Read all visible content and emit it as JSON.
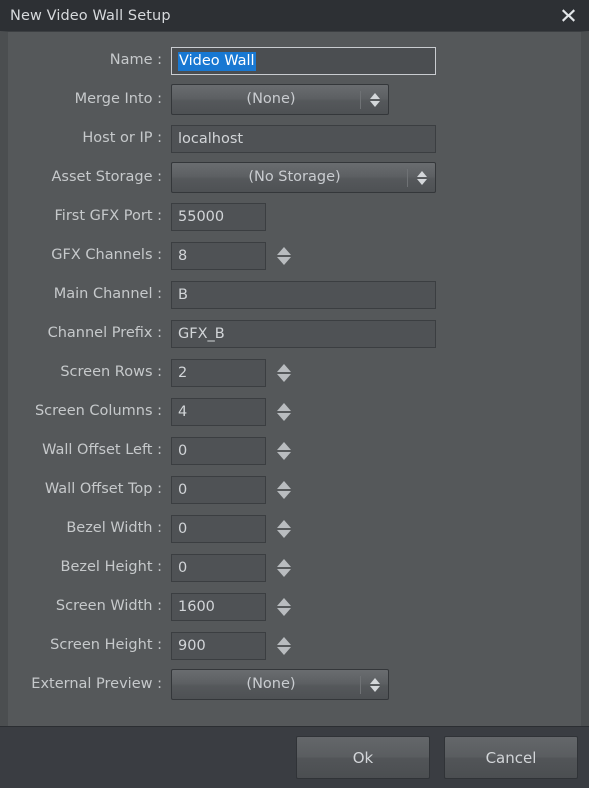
{
  "window": {
    "title": "New Video Wall Setup",
    "close_icon": "close-icon"
  },
  "colors": {
    "titlebar_bg": "#2d3034",
    "body_bg": "#55585a",
    "footer_bg": "#3a3d42",
    "input_bg": "#4f5255",
    "text": "#c6c9cb",
    "selection_blue": "#1878d2",
    "focus_border": "#c9ccd0"
  },
  "form": {
    "rows": [
      {
        "label": "Name :",
        "type": "text",
        "value": "Video Wall",
        "focused": true,
        "selected": true,
        "width": "wide"
      },
      {
        "label": "Merge Into :",
        "type": "combo",
        "value": "(None)",
        "width": "narrow"
      },
      {
        "label": "Host or IP :",
        "type": "text",
        "value": "localhost",
        "width": "wide"
      },
      {
        "label": "Asset Storage :",
        "type": "combo",
        "value": "(No Storage)",
        "width": "wide"
      },
      {
        "label": "First GFX Port :",
        "type": "text",
        "value": "55000",
        "width": "port"
      },
      {
        "label": "GFX Channels :",
        "type": "spin",
        "value": "8"
      },
      {
        "label": "Main Channel :",
        "type": "text",
        "value": "B",
        "width": "wide"
      },
      {
        "label": "Channel Prefix :",
        "type": "text",
        "value": "GFX_B",
        "width": "wide"
      },
      {
        "label": "Screen Rows :",
        "type": "spin",
        "value": "2"
      },
      {
        "label": "Screen Columns :",
        "type": "spin",
        "value": "4"
      },
      {
        "label": "Wall Offset Left :",
        "type": "spin",
        "value": "0"
      },
      {
        "label": "Wall Offset Top :",
        "type": "spin",
        "value": "0"
      },
      {
        "label": "Bezel Width :",
        "type": "spin",
        "value": "0"
      },
      {
        "label": "Bezel Height :",
        "type": "spin",
        "value": "0"
      },
      {
        "label": "Screen Width :",
        "type": "spin",
        "value": "1600"
      },
      {
        "label": "Screen Height :",
        "type": "spin",
        "value": "900"
      },
      {
        "label": "External Preview :",
        "type": "combo",
        "value": "(None)",
        "width": "narrow"
      }
    ]
  },
  "footer": {
    "ok_label": "Ok",
    "cancel_label": "Cancel"
  }
}
